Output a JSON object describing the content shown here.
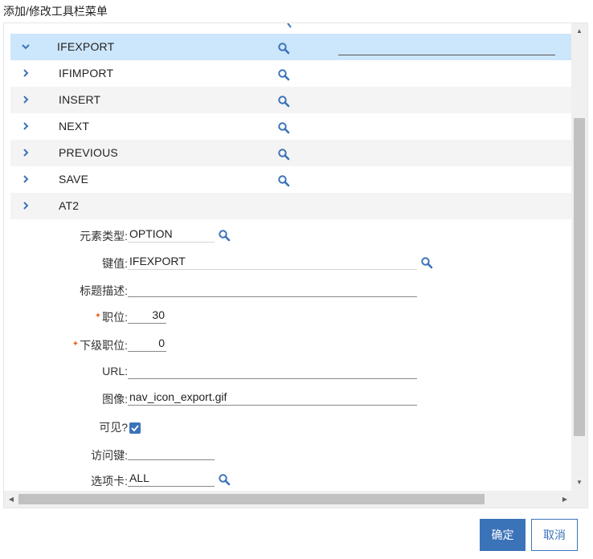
{
  "dialog": {
    "title": "添加/修改工具栏菜单"
  },
  "menu_rows": [
    {
      "label": "IFEXPORT",
      "expanded": true,
      "selected": true
    },
    {
      "label": "IFIMPORT"
    },
    {
      "label": "INSERT"
    },
    {
      "label": "NEXT"
    },
    {
      "label": "PREVIOUS"
    },
    {
      "label": "SAVE"
    },
    {
      "label": "AT2"
    }
  ],
  "detail": {
    "element_type": {
      "label": "元素类型:",
      "value": "OPTION"
    },
    "key_value": {
      "label": "键值:",
      "value": "IFEXPORT"
    },
    "title_desc": {
      "label": "标题描述:",
      "value": ""
    },
    "position": {
      "label": "职位:",
      "value": "30",
      "required": true
    },
    "sub_position": {
      "label": "下级职位:",
      "value": "0",
      "required": true
    },
    "url": {
      "label": "URL:",
      "value": ""
    },
    "image": {
      "label": "图像:",
      "value": "nav_icon_export.gif"
    },
    "visible": {
      "label": "可见?",
      "checked": true
    },
    "access_key": {
      "label": "访问键:",
      "value": ""
    },
    "tab": {
      "label": "选项卡:",
      "value": "ALL"
    }
  },
  "buttons": {
    "ok": "确定",
    "cancel": "取消"
  },
  "colors": {
    "accent": "#3b73b9",
    "selected_row": "#cce6fb",
    "required_marker": "#e36c24"
  }
}
